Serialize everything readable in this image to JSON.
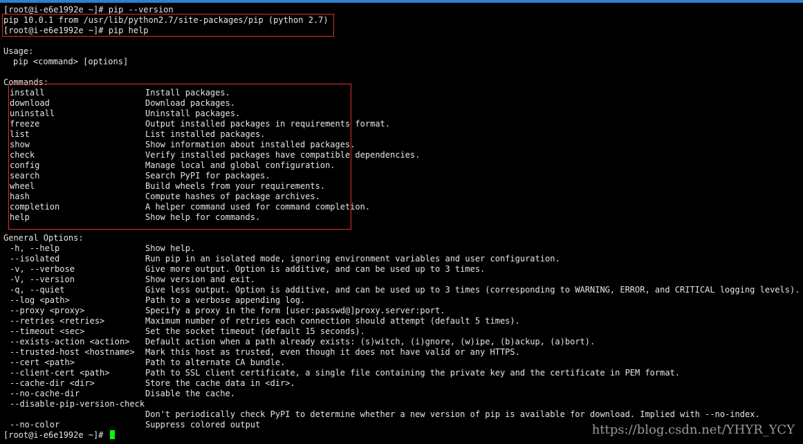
{
  "terminal": {
    "prompt1": "[root@i-e6e1992e ~]# pip --version",
    "version_output": "pip 10.0.1 from /usr/lib/python2.7/site-packages/pip (python 2.7)",
    "prompt2": "[root@i-e6e1992e ~]# pip help",
    "usage_heading": "Usage:",
    "usage_text": "pip <command> [options]",
    "commands_heading": "Commands:",
    "commands": [
      {
        "name": "install",
        "desc": "Install packages."
      },
      {
        "name": "download",
        "desc": "Download packages."
      },
      {
        "name": "uninstall",
        "desc": "Uninstall packages."
      },
      {
        "name": "freeze",
        "desc": "Output installed packages in requirements format."
      },
      {
        "name": "list",
        "desc": "List installed packages."
      },
      {
        "name": "show",
        "desc": "Show information about installed packages."
      },
      {
        "name": "check",
        "desc": "Verify installed packages have compatible dependencies."
      },
      {
        "name": "config",
        "desc": "Manage local and global configuration."
      },
      {
        "name": "search",
        "desc": "Search PyPI for packages."
      },
      {
        "name": "wheel",
        "desc": "Build wheels from your requirements."
      },
      {
        "name": "hash",
        "desc": "Compute hashes of package archives."
      },
      {
        "name": "completion",
        "desc": "A helper command used for command completion."
      },
      {
        "name": "help",
        "desc": "Show help for commands."
      }
    ],
    "options_heading": "General Options:",
    "options": [
      {
        "name": "-h, --help",
        "desc": "Show help."
      },
      {
        "name": "--isolated",
        "desc": "Run pip in an isolated mode, ignoring environment variables and user configuration."
      },
      {
        "name": "-v, --verbose",
        "desc": "Give more output. Option is additive, and can be used up to 3 times."
      },
      {
        "name": "-V, --version",
        "desc": "Show version and exit."
      },
      {
        "name": "-q, --quiet",
        "desc": "Give less output. Option is additive, and can be used up to 3 times (corresponding to WARNING, ERROR, and CRITICAL logging levels)."
      },
      {
        "name": "--log <path>",
        "desc": "Path to a verbose appending log."
      },
      {
        "name": "--proxy <proxy>",
        "desc": "Specify a proxy in the form [user:passwd@]proxy.server:port."
      },
      {
        "name": "--retries <retries>",
        "desc": "Maximum number of retries each connection should attempt (default 5 times)."
      },
      {
        "name": "--timeout <sec>",
        "desc": "Set the socket timeout (default 15 seconds)."
      },
      {
        "name": "--exists-action <action>",
        "desc": "Default action when a path already exists: (s)witch, (i)gnore, (w)ipe, (b)ackup, (a)bort)."
      },
      {
        "name": "--trusted-host <hostname>",
        "desc": "Mark this host as trusted, even though it does not have valid or any HTTPS."
      },
      {
        "name": "--cert <path>",
        "desc": "Path to alternate CA bundle."
      },
      {
        "name": "--client-cert <path>",
        "desc": "Path to SSL client certificate, a single file containing the private key and the certificate in PEM format."
      },
      {
        "name": "--cache-dir <dir>",
        "desc": "Store the cache data in <dir>."
      },
      {
        "name": "--no-cache-dir",
        "desc": "Disable the cache."
      },
      {
        "name": "--disable-pip-version-check",
        "desc": ""
      },
      {
        "name": "",
        "desc": "Don't periodically check PyPI to determine whether a new version of pip is available for download. Implied with --no-index."
      },
      {
        "name": "--no-color",
        "desc": "Suppress colored output"
      }
    ],
    "final_prompt": "[root@i-e6e1992e ~]# ",
    "watermark": "https://blog.csdn.net/YHYR_YCY"
  },
  "colors": {
    "background": "#000000",
    "text": "#e6e6e6",
    "cursor": "#00ff00",
    "highlight_box": "#e03030",
    "window_accent": "#2f7fcf"
  }
}
